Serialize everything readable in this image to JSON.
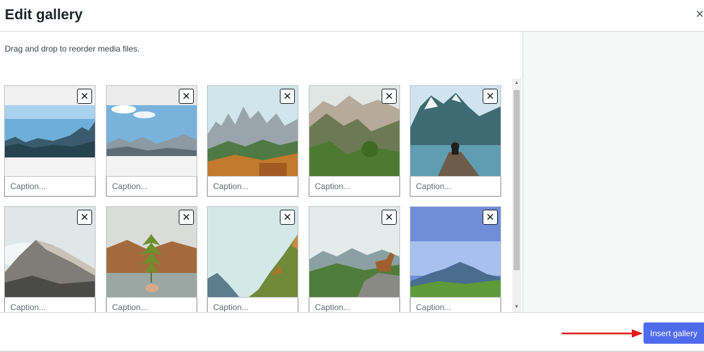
{
  "modal": {
    "title": "Edit gallery",
    "close_glyph": "×"
  },
  "instructions": "Drag and drop to reorder media files.",
  "gallery": {
    "remove_glyph": "✕",
    "caption_placeholder": "Caption...",
    "items": [
      {
        "name": "mountain-lake-panorama"
      },
      {
        "name": "snowy-mountain-range"
      },
      {
        "name": "alpine-valley-autumn"
      },
      {
        "name": "green-mountain-valley"
      },
      {
        "name": "person-on-pier-lake"
      },
      {
        "name": "rocky-cliff-clouds"
      },
      {
        "name": "fern-leaf-lake"
      },
      {
        "name": "sky-mountain-slopes"
      },
      {
        "name": "goat-on-rock-meadow"
      },
      {
        "name": "blue-sky-green-hills"
      }
    ]
  },
  "footer": {
    "insert_label": "Insert gallery"
  },
  "colors": {
    "primary_button": "#4f6bed",
    "arrow": "#e01b1b"
  }
}
